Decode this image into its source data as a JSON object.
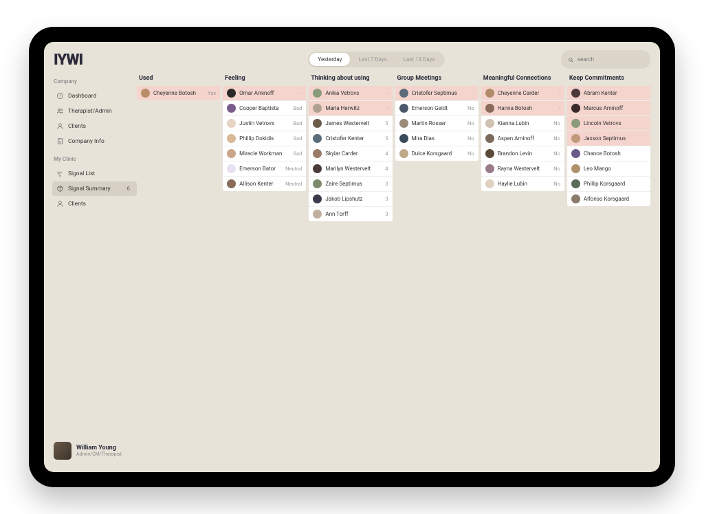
{
  "logo": "IYWI",
  "nav": {
    "company_label": "Company",
    "company_items": [
      {
        "icon": "clock",
        "label": "Dashboard"
      },
      {
        "icon": "users",
        "label": "Therapist/Admin"
      },
      {
        "icon": "person",
        "label": "Clients"
      },
      {
        "icon": "building",
        "label": "Company Info"
      }
    ],
    "clinic_label": "My Clinic",
    "clinic_items": [
      {
        "icon": "signal",
        "label": "Signal List"
      },
      {
        "icon": "summary",
        "label": "Signal Summary",
        "count": "6",
        "active": true
      },
      {
        "icon": "person",
        "label": "Clients"
      }
    ]
  },
  "user": {
    "name": "William Young",
    "role": "Admin/CM/Therapist"
  },
  "tabs": [
    {
      "label": "Yesterday",
      "active": true
    },
    {
      "label": "Last 7 Days"
    },
    {
      "label": "Last 14 Days"
    }
  ],
  "search_placeholder": "search",
  "columns": [
    {
      "title": "Used",
      "items": [
        {
          "name": "Cheyenne Botosh",
          "val": "Yes",
          "flag": true,
          "c": "#b98c6a"
        }
      ]
    },
    {
      "title": "Feeling",
      "items": [
        {
          "name": "Omar Aminoff",
          "val": "-",
          "flag": true,
          "c": "#2a2a2a"
        },
        {
          "name": "Cooper Baptista",
          "val": "Bad",
          "c": "#7a5c8c"
        },
        {
          "name": "Justin Vetrovs",
          "val": "Bad",
          "c": "#e6d5c3"
        },
        {
          "name": "Phillip Dokidis",
          "val": "Sad",
          "c": "#d9b896"
        },
        {
          "name": "Miracle Workman",
          "val": "Sad",
          "c": "#c9a58a"
        },
        {
          "name": "Emerson Bator",
          "val": "Neutral",
          "c": "#e8e0f0"
        },
        {
          "name": "Allison Kenter",
          "val": "Neutral",
          "c": "#8a6b5a"
        }
      ]
    },
    {
      "title": "Thinking about using",
      "items": [
        {
          "name": "Anika Vetrovs",
          "val": "-",
          "flag": true,
          "c": "#8a9b7a"
        },
        {
          "name": "Maria Herwitz",
          "val": "-",
          "flag": true,
          "c": "#b0a090"
        },
        {
          "name": "James Westervelt",
          "val": "5",
          "c": "#6b5b4a"
        },
        {
          "name": "Cristofer Kenter",
          "val": "5",
          "c": "#5a6b7a"
        },
        {
          "name": "Skylar Carder",
          "val": "4",
          "c": "#9a7b6a"
        },
        {
          "name": "Marilyn Westervelt",
          "val": "4",
          "c": "#4a3a3a"
        },
        {
          "name": "Zaire Septimus",
          "val": "3",
          "c": "#7a8a6b"
        },
        {
          "name": "Jakob Lipshutz",
          "val": "3",
          "c": "#3a3a4a"
        },
        {
          "name": "Ann Torff",
          "val": "3",
          "c": "#c0b0a0"
        }
      ]
    },
    {
      "title": "Group Meetings",
      "items": [
        {
          "name": "Cristofer Septimus",
          "val": "-",
          "flag": true,
          "c": "#5a6b7a"
        },
        {
          "name": "Emerson Geidt",
          "val": "No",
          "c": "#4a5a6a"
        },
        {
          "name": "Martin Rosser",
          "val": "No",
          "c": "#9a8b7a"
        },
        {
          "name": "Mira Dias",
          "val": "No",
          "c": "#3a4a5a"
        },
        {
          "name": "Dulce Korsgaard",
          "val": "No",
          "c": "#c0a88a"
        }
      ]
    },
    {
      "title": "Meaningful Connections",
      "items": [
        {
          "name": "Cheyenne Carder",
          "val": "-",
          "flag": true,
          "c": "#b08a6a"
        },
        {
          "name": "Hanna Botosh",
          "val": "-",
          "flag": true,
          "c": "#8a6b5a"
        },
        {
          "name": "Kianna Lubin",
          "val": "No",
          "c": "#d0c0b0"
        },
        {
          "name": "Aspen Aminoff",
          "val": "No",
          "c": "#7a6b5a"
        },
        {
          "name": "Brandon Levin",
          "val": "No",
          "c": "#5a4a3a"
        },
        {
          "name": "Rayna Westervelt",
          "val": "No",
          "c": "#9a7b8a"
        },
        {
          "name": "Haylie Lubin",
          "val": "No",
          "c": "#e0d0c0"
        }
      ]
    },
    {
      "title": "Keep Commitments",
      "items": [
        {
          "name": "Abram Kenter",
          "val": "",
          "flag": true,
          "c": "#4a3a3a"
        },
        {
          "name": "Marcus Aminoff",
          "val": "",
          "flag": true,
          "c": "#3a2a2a"
        },
        {
          "name": "Lincoln Vetrovs",
          "val": "",
          "flag": true,
          "c": "#8a9b7a"
        },
        {
          "name": "Jaxson Septimus",
          "val": "",
          "flag": true,
          "c": "#c09a7a"
        },
        {
          "name": "Chance Botosh",
          "val": "",
          "c": "#6a5a8a"
        },
        {
          "name": "Leo Mango",
          "val": "",
          "c": "#b0906a"
        },
        {
          "name": "Phillip Korsgaard",
          "val": "",
          "c": "#5a6b5a"
        },
        {
          "name": "Alfonso Korsgaard",
          "val": "",
          "c": "#8a7b6a"
        }
      ]
    }
  ]
}
